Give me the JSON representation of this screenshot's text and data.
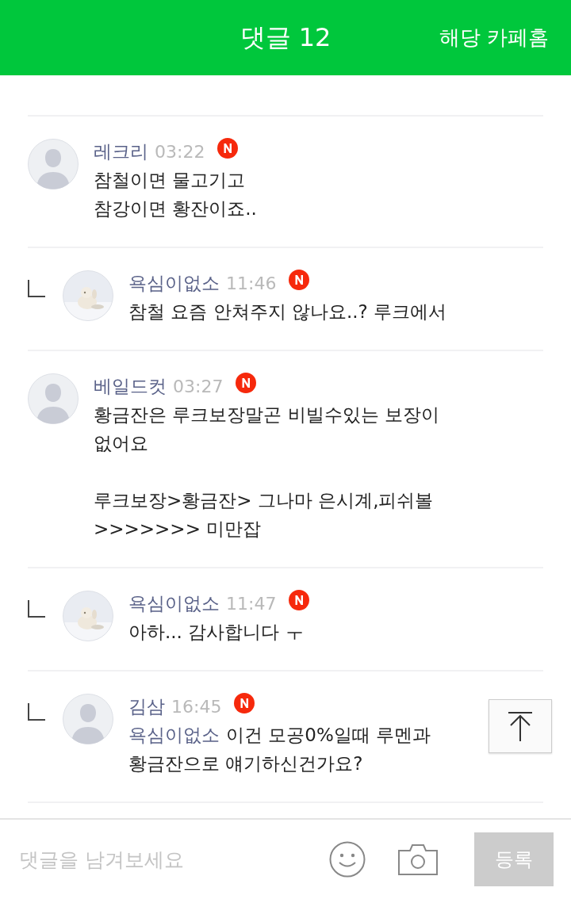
{
  "header": {
    "title": "댓글 12",
    "link": "해당 카페홈"
  },
  "comments": [
    {
      "author": "레크리",
      "time": "03:22",
      "is_new": true,
      "reply": false,
      "photo_avatar": false,
      "text": "참철이면 물고기고\n참강이면 황잔이죠.."
    },
    {
      "author": "욕심이없소",
      "time": "11:46",
      "is_new": true,
      "reply": true,
      "photo_avatar": true,
      "text": "참철 요즘 안쳐주지 않나요..? 루크에서"
    },
    {
      "author": "베일드컷",
      "time": "03:27",
      "is_new": true,
      "reply": false,
      "photo_avatar": false,
      "text": "황금잔은 루크보장말곤 비빌수있는 보장이 없어요\n\n루크보장>황금잔> 그나마 은시계,피쉬볼 >>>>>>> 미만잡"
    },
    {
      "author": "욕심이없소",
      "time": "11:47",
      "is_new": true,
      "reply": true,
      "photo_avatar": true,
      "text": "아하... 감사합니다 ㅜ"
    },
    {
      "author": "김삼",
      "time": "16:45",
      "is_new": true,
      "reply": true,
      "photo_avatar": false,
      "mention": "욕심이없소",
      "text": "이건 모공0%일때 루멘과 황금잔으로 얘기하신건가요?"
    }
  ],
  "composer": {
    "placeholder": "댓글을 남겨보세요",
    "submit": "등록"
  }
}
